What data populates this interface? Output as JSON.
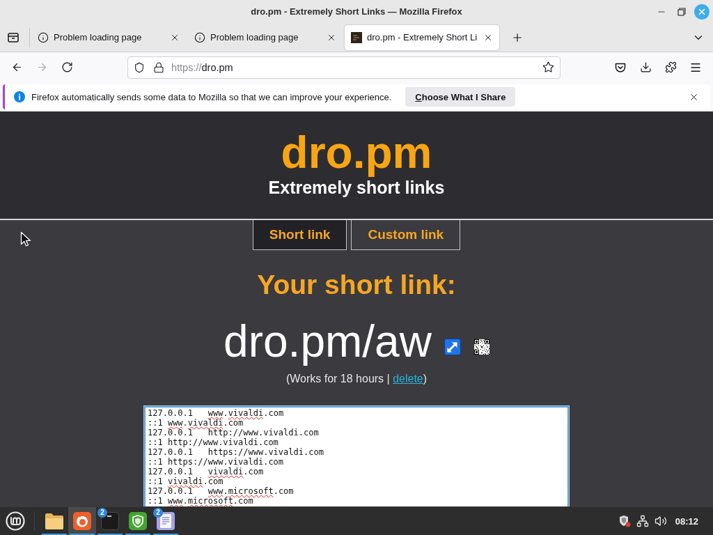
{
  "window": {
    "title": "dro.pm - Extremely Short Links — Mozilla Firefox"
  },
  "tabs": [
    {
      "kind": "error",
      "title": "Problem loading page",
      "selected": false
    },
    {
      "kind": "error",
      "title": "Problem loading page",
      "selected": false
    },
    {
      "kind": "site",
      "title": "dro.pm - Extremely Short Li",
      "selected": true
    }
  ],
  "toolbar": {
    "buttons": [
      {
        "kind": "back",
        "disabled": false
      },
      {
        "kind": "forward",
        "disabled": true
      },
      {
        "kind": "reload",
        "disabled": false
      }
    ],
    "url": {
      "scheme": "https://",
      "host": "dro.pm"
    }
  },
  "notification": {
    "message": "Firefox automatically sends some data to Mozilla so that we can improve your experience.",
    "button": "Choose What I Share"
  },
  "page": {
    "logo": "dro.pm",
    "tagline": "Extremely short links",
    "modes": [
      {
        "label": "Short link",
        "selected": true
      },
      {
        "label": "Custom link",
        "selected": false
      }
    ],
    "heading": "Your short link:",
    "short_link": "dro.pm/aw",
    "note": {
      "before": "(Works for 18 hours | ",
      "link": "delete",
      "after": ")"
    },
    "textarea": {
      "lines": [
        {
          "segments": [
            {
              "text": "127.0.0.1   ",
              "misspelled": false
            },
            {
              "text": "www",
              "misspelled": true
            },
            {
              "text": ".",
              "misspelled": false
            },
            {
              "text": "vivaldi",
              "misspelled": true
            },
            {
              "text": ".com",
              "misspelled": false
            }
          ]
        },
        {
          "segments": [
            {
              "text": "::1 ",
              "misspelled": false
            },
            {
              "text": "www",
              "misspelled": true
            },
            {
              "text": ".",
              "misspelled": false
            },
            {
              "text": "vivaldi",
              "misspelled": true
            },
            {
              "text": ".com",
              "misspelled": false
            }
          ]
        },
        {
          "segments": [
            {
              "text": "127.0.0.1   http://www.vivaldi.com",
              "misspelled": false
            }
          ]
        },
        {
          "segments": [
            {
              "text": "::1 http://www.vivaldi.com",
              "misspelled": false
            }
          ]
        },
        {
          "segments": [
            {
              "text": "127.0.0.1   https://www.vivaldi.com",
              "misspelled": false
            }
          ]
        },
        {
          "segments": [
            {
              "text": "::1 https://www.vivaldi.com",
              "misspelled": false
            }
          ]
        },
        {
          "segments": [
            {
              "text": "127.0.0.1   ",
              "misspelled": false
            },
            {
              "text": "vivaldi",
              "misspelled": true
            },
            {
              "text": ".com",
              "misspelled": false
            }
          ]
        },
        {
          "segments": [
            {
              "text": "::1 ",
              "misspelled": false
            },
            {
              "text": "vivaldi",
              "misspelled": true
            },
            {
              "text": ".com",
              "misspelled": false
            }
          ]
        },
        {
          "segments": [
            {
              "text": "127.0.0.1   ",
              "misspelled": false
            },
            {
              "text": "www",
              "misspelled": true
            },
            {
              "text": ".",
              "misspelled": false
            },
            {
              "text": "microsoft",
              "misspelled": true
            },
            {
              "text": ".com",
              "misspelled": false
            }
          ]
        },
        {
          "segments": [
            {
              "text": "::1 ",
              "misspelled": false
            },
            {
              "text": "www",
              "misspelled": true
            },
            {
              "text": ".",
              "misspelled": false
            },
            {
              "text": "microsoft",
              "misspelled": true
            },
            {
              "text": ".com",
              "misspelled": false
            }
          ]
        }
      ]
    }
  },
  "taskbar": {
    "apps": [
      {
        "kind": "files",
        "focused": false,
        "running": true
      },
      {
        "kind": "browser",
        "focused": true,
        "running": true
      },
      {
        "kind": "terminal",
        "focused": false,
        "running": true,
        "badge": "2"
      },
      {
        "kind": "shield",
        "focused": false,
        "running": true
      },
      {
        "kind": "editor",
        "focused": false,
        "running": true,
        "badge": "2"
      }
    ],
    "clock": "08:12"
  }
}
